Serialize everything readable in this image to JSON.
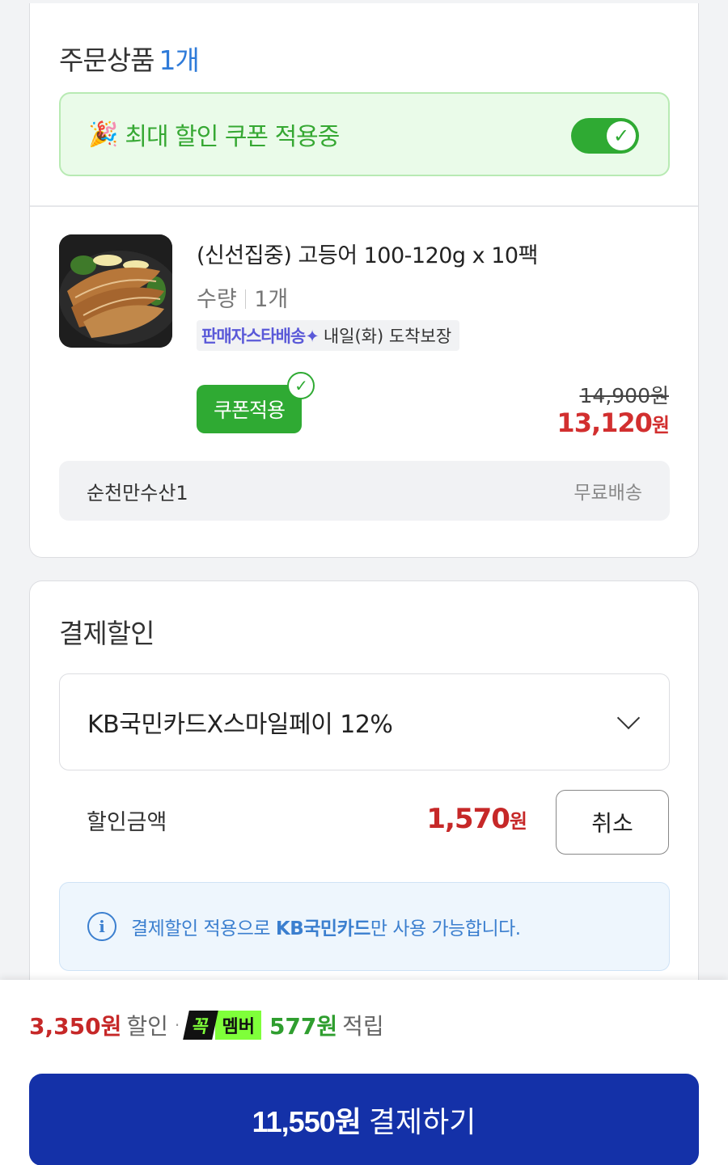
{
  "order": {
    "title": "주문상품",
    "count": "1개",
    "coupon_banner": {
      "emoji": "🎉",
      "text": "최대 할인 쿠폰 적용중",
      "toggle_on": true
    },
    "product": {
      "name": "(신선집중) 고등어 100-120g x 10팩",
      "qty_label": "수량",
      "qty_value": "1개",
      "delivery_badge": "판매자스타배송✦",
      "delivery_text": "내일(화) 도착보장",
      "coupon_chip": "쿠폰적용",
      "original_price": "14,900원",
      "sale_price": "13,120",
      "sale_unit": "원"
    },
    "seller": {
      "name": "순천만수산1",
      "shipping": "무료배송"
    }
  },
  "payment": {
    "title": "결제할인",
    "selected_card": "KB국민카드X스마일페이 12%",
    "discount_label": "할인금액",
    "discount_amount": "1,570",
    "discount_unit": "원",
    "cancel_label": "취소",
    "info_pre": "결제할인 적용으로 ",
    "info_bold": "KB국민카드",
    "info_post": "만 사용 가능합니다."
  },
  "bottom": {
    "discount_total": "3,350원",
    "discount_word": "할인",
    "dot": "·",
    "member_k": "꼭",
    "member_m": "멤버",
    "points": "577원",
    "points_word": "적립",
    "pay_amount": "11,550원",
    "pay_label": "결제하기"
  },
  "colors": {
    "accent_blue": "#1431a8",
    "green": "#2faa33",
    "red": "#d22f2f"
  }
}
